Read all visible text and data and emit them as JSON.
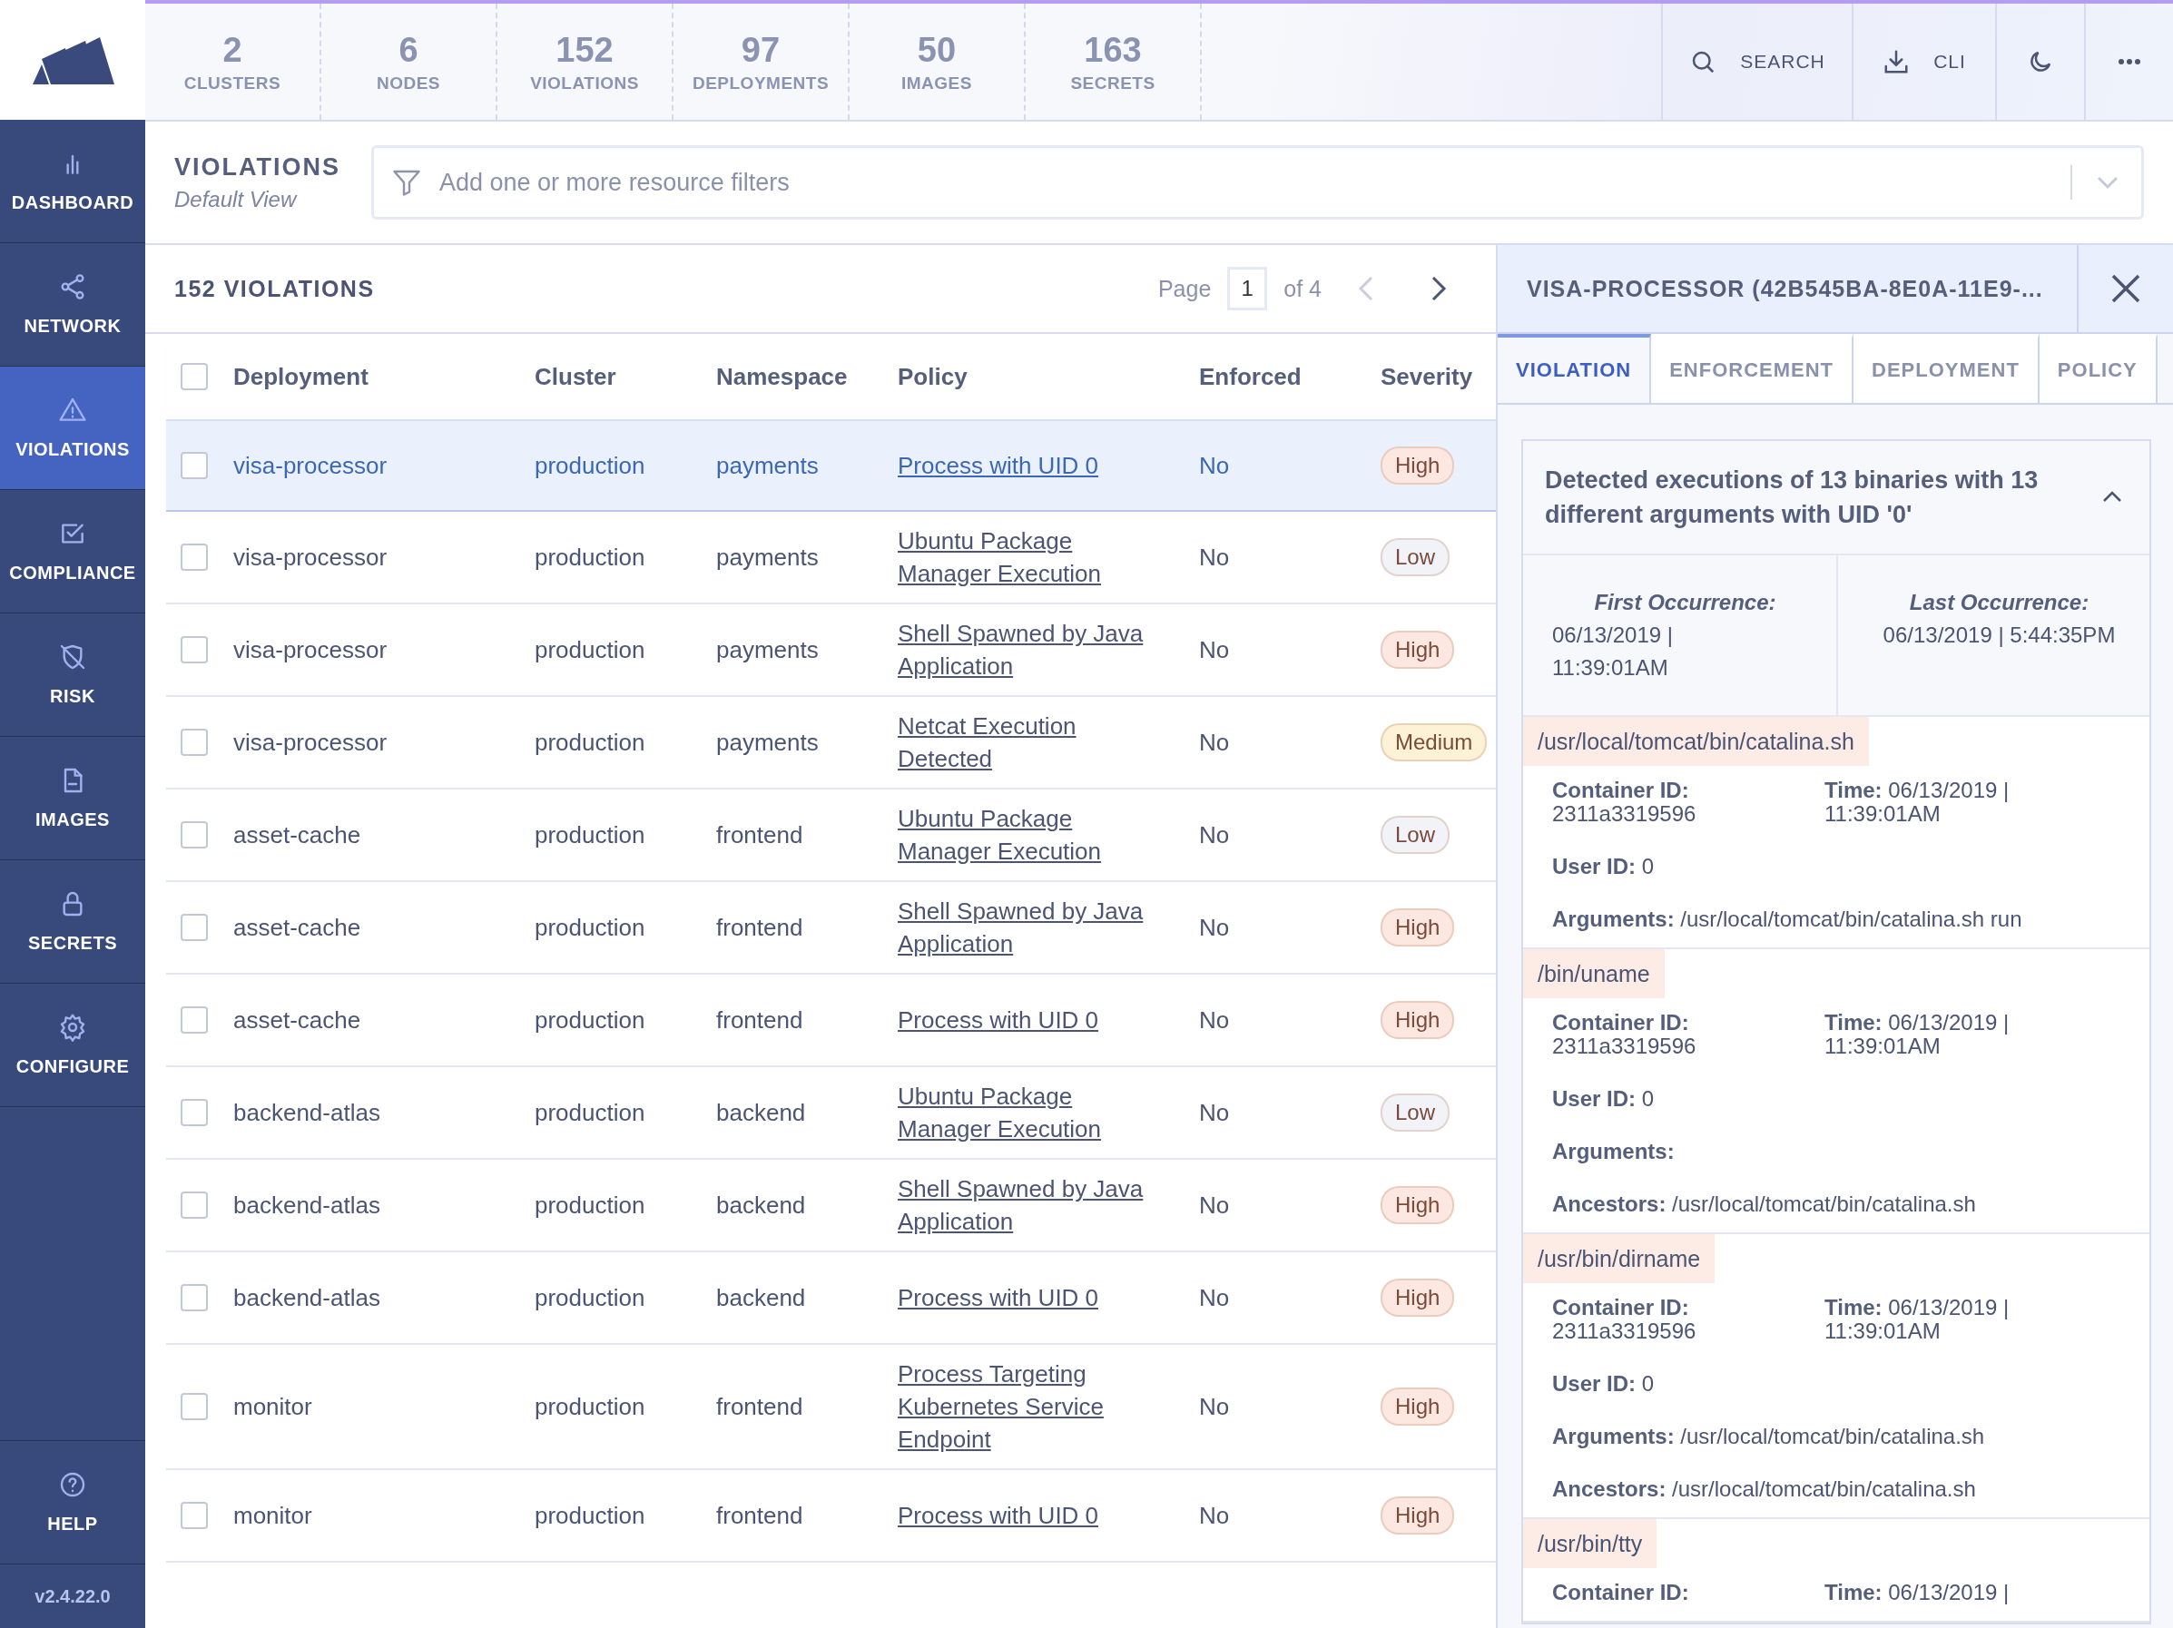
{
  "sidebar": {
    "items": [
      {
        "label": "DASHBOARD",
        "selected": false
      },
      {
        "label": "NETWORK",
        "selected": false
      },
      {
        "label": "VIOLATIONS",
        "selected": true
      },
      {
        "label": "COMPLIANCE",
        "selected": false
      },
      {
        "label": "RISK",
        "selected": false
      },
      {
        "label": "IMAGES",
        "selected": false
      },
      {
        "label": "SECRETS",
        "selected": false
      },
      {
        "label": "CONFIGURE",
        "selected": false
      }
    ],
    "help": "HELP",
    "version": "v2.4.22.0"
  },
  "stats": [
    {
      "value": "2",
      "label": "CLUSTERS"
    },
    {
      "value": "6",
      "label": "NODES"
    },
    {
      "value": "152",
      "label": "VIOLATIONS"
    },
    {
      "value": "97",
      "label": "DEPLOYMENTS"
    },
    {
      "value": "50",
      "label": "IMAGES"
    },
    {
      "value": "163",
      "label": "SECRETS"
    }
  ],
  "top_actions": {
    "search": "SEARCH",
    "cli": "CLI"
  },
  "page": {
    "title": "VIOLATIONS",
    "subtitle": "Default View"
  },
  "filter": {
    "placeholder": "Add one or more resource filters"
  },
  "table": {
    "count": "152 VIOLATIONS",
    "pagination": {
      "label": "Page",
      "page": "1",
      "of": "of 4",
      "prev_disabled": true
    },
    "all_checked": false,
    "columns": [
      "Deployment",
      "Cluster",
      "Namespace",
      "Policy",
      "Enforced",
      "Severity"
    ],
    "rows": [
      {
        "deployment": "visa-processor",
        "cluster": "production",
        "namespace": "payments",
        "policy": "Process with UID 0",
        "enforced": "No",
        "severity": "High",
        "color": "#fde8e1",
        "selected": true,
        "checked": false
      },
      {
        "deployment": "visa-processor",
        "cluster": "production",
        "namespace": "payments",
        "policy": "Ubuntu Package Manager Execution",
        "enforced": "No",
        "severity": "Low",
        "color": "#f1f3f9",
        "selected": false,
        "checked": false
      },
      {
        "deployment": "visa-processor",
        "cluster": "production",
        "namespace": "payments",
        "policy": "Shell Spawned by Java Application",
        "enforced": "No",
        "severity": "High",
        "color": "#fde8e1",
        "selected": false,
        "checked": false
      },
      {
        "deployment": "visa-processor",
        "cluster": "production",
        "namespace": "payments",
        "policy": "Netcat Execution Detected",
        "enforced": "No",
        "severity": "Medium",
        "color": "#fdf2d6",
        "selected": false,
        "checked": false
      },
      {
        "deployment": "asset-cache",
        "cluster": "production",
        "namespace": "frontend",
        "policy": "Ubuntu Package Manager Execution",
        "enforced": "No",
        "severity": "Low",
        "color": "#f1f3f9",
        "selected": false,
        "checked": false
      },
      {
        "deployment": "asset-cache",
        "cluster": "production",
        "namespace": "frontend",
        "policy": "Shell Spawned by Java Application",
        "enforced": "No",
        "severity": "High",
        "color": "#fde8e1",
        "selected": false,
        "checked": false
      },
      {
        "deployment": "asset-cache",
        "cluster": "production",
        "namespace": "frontend",
        "policy": "Process with UID 0",
        "enforced": "No",
        "severity": "High",
        "color": "#fde8e1",
        "selected": false,
        "checked": false
      },
      {
        "deployment": "backend-atlas",
        "cluster": "production",
        "namespace": "backend",
        "policy": "Ubuntu Package Manager Execution",
        "enforced": "No",
        "severity": "Low",
        "color": "#f1f3f9",
        "selected": false,
        "checked": false
      },
      {
        "deployment": "backend-atlas",
        "cluster": "production",
        "namespace": "backend",
        "policy": "Shell Spawned by Java Application",
        "enforced": "No",
        "severity": "High",
        "color": "#fde8e1",
        "selected": false,
        "checked": false
      },
      {
        "deployment": "backend-atlas",
        "cluster": "production",
        "namespace": "backend",
        "policy": "Process with UID 0",
        "enforced": "No",
        "severity": "High",
        "color": "#fde8e1",
        "selected": false,
        "checked": false
      },
      {
        "deployment": "monitor",
        "cluster": "production",
        "namespace": "frontend",
        "policy": "Process Targeting Kubernetes Service Endpoint",
        "enforced": "No",
        "severity": "High",
        "color": "#fde8e1",
        "selected": false,
        "checked": false
      },
      {
        "deployment": "monitor",
        "cluster": "production",
        "namespace": "frontend",
        "policy": "Process with UID 0",
        "enforced": "No",
        "severity": "High",
        "color": "#fde8e1",
        "selected": false,
        "checked": false
      }
    ]
  },
  "panel": {
    "title": "VISA-PROCESSOR (42B545BA-8E0A-11E9-...",
    "tabs": [
      {
        "label": "VIOLATION",
        "selected": true
      },
      {
        "label": "ENFORCEMENT",
        "selected": false
      },
      {
        "label": "DEPLOYMENT",
        "selected": false
      },
      {
        "label": "POLICY",
        "selected": false
      }
    ],
    "card": {
      "title": "Detected executions of 13 binaries with 13 different arguments with UID '0'",
      "expanded": true,
      "first": {
        "label": "First Occurrence:",
        "value": "06/13/2019 | 11:39:01AM"
      },
      "last": {
        "label": "Last Occurrence:",
        "value": "06/13/2019 | 5:44:35PM"
      },
      "processes": [
        {
          "path": "/usr/local/tomcat/bin/catalina.sh",
          "fields": [
            {
              "label": "Container ID:",
              "value": "2311a3319596"
            },
            {
              "label": "Time:",
              "value": "06/13/2019 | 11:39:01AM"
            },
            {
              "label": "User ID:",
              "value": "0"
            },
            {
              "label": "Arguments:",
              "value": "/usr/local/tomcat/bin/catalina.sh run"
            }
          ]
        },
        {
          "path": "/bin/uname",
          "fields": [
            {
              "label": "Container ID:",
              "value": "2311a3319596"
            },
            {
              "label": "Time:",
              "value": "06/13/2019 | 11:39:01AM"
            },
            {
              "label": "User ID:",
              "value": "0"
            },
            {
              "label": "Arguments:"
            },
            {
              "label": "Ancestors:",
              "value": "/usr/local/tomcat/bin/catalina.sh"
            }
          ]
        },
        {
          "path": "/usr/bin/dirname",
          "fields": [
            {
              "label": "Container ID:",
              "value": "2311a3319596"
            },
            {
              "label": "Time:",
              "value": "06/13/2019 | 11:39:01AM"
            },
            {
              "label": "User ID:",
              "value": "0"
            },
            {
              "label": "Arguments:",
              "value": "/usr/local/tomcat/bin/catalina.sh"
            },
            {
              "label": "Ancestors:",
              "value": "/usr/local/tomcat/bin/catalina.sh"
            }
          ]
        },
        {
          "path": "/usr/bin/tty",
          "fields": [
            {
              "label": "Container ID:"
            },
            {
              "label": "Time:",
              "value": "06/13/2019 |"
            }
          ]
        }
      ]
    }
  }
}
